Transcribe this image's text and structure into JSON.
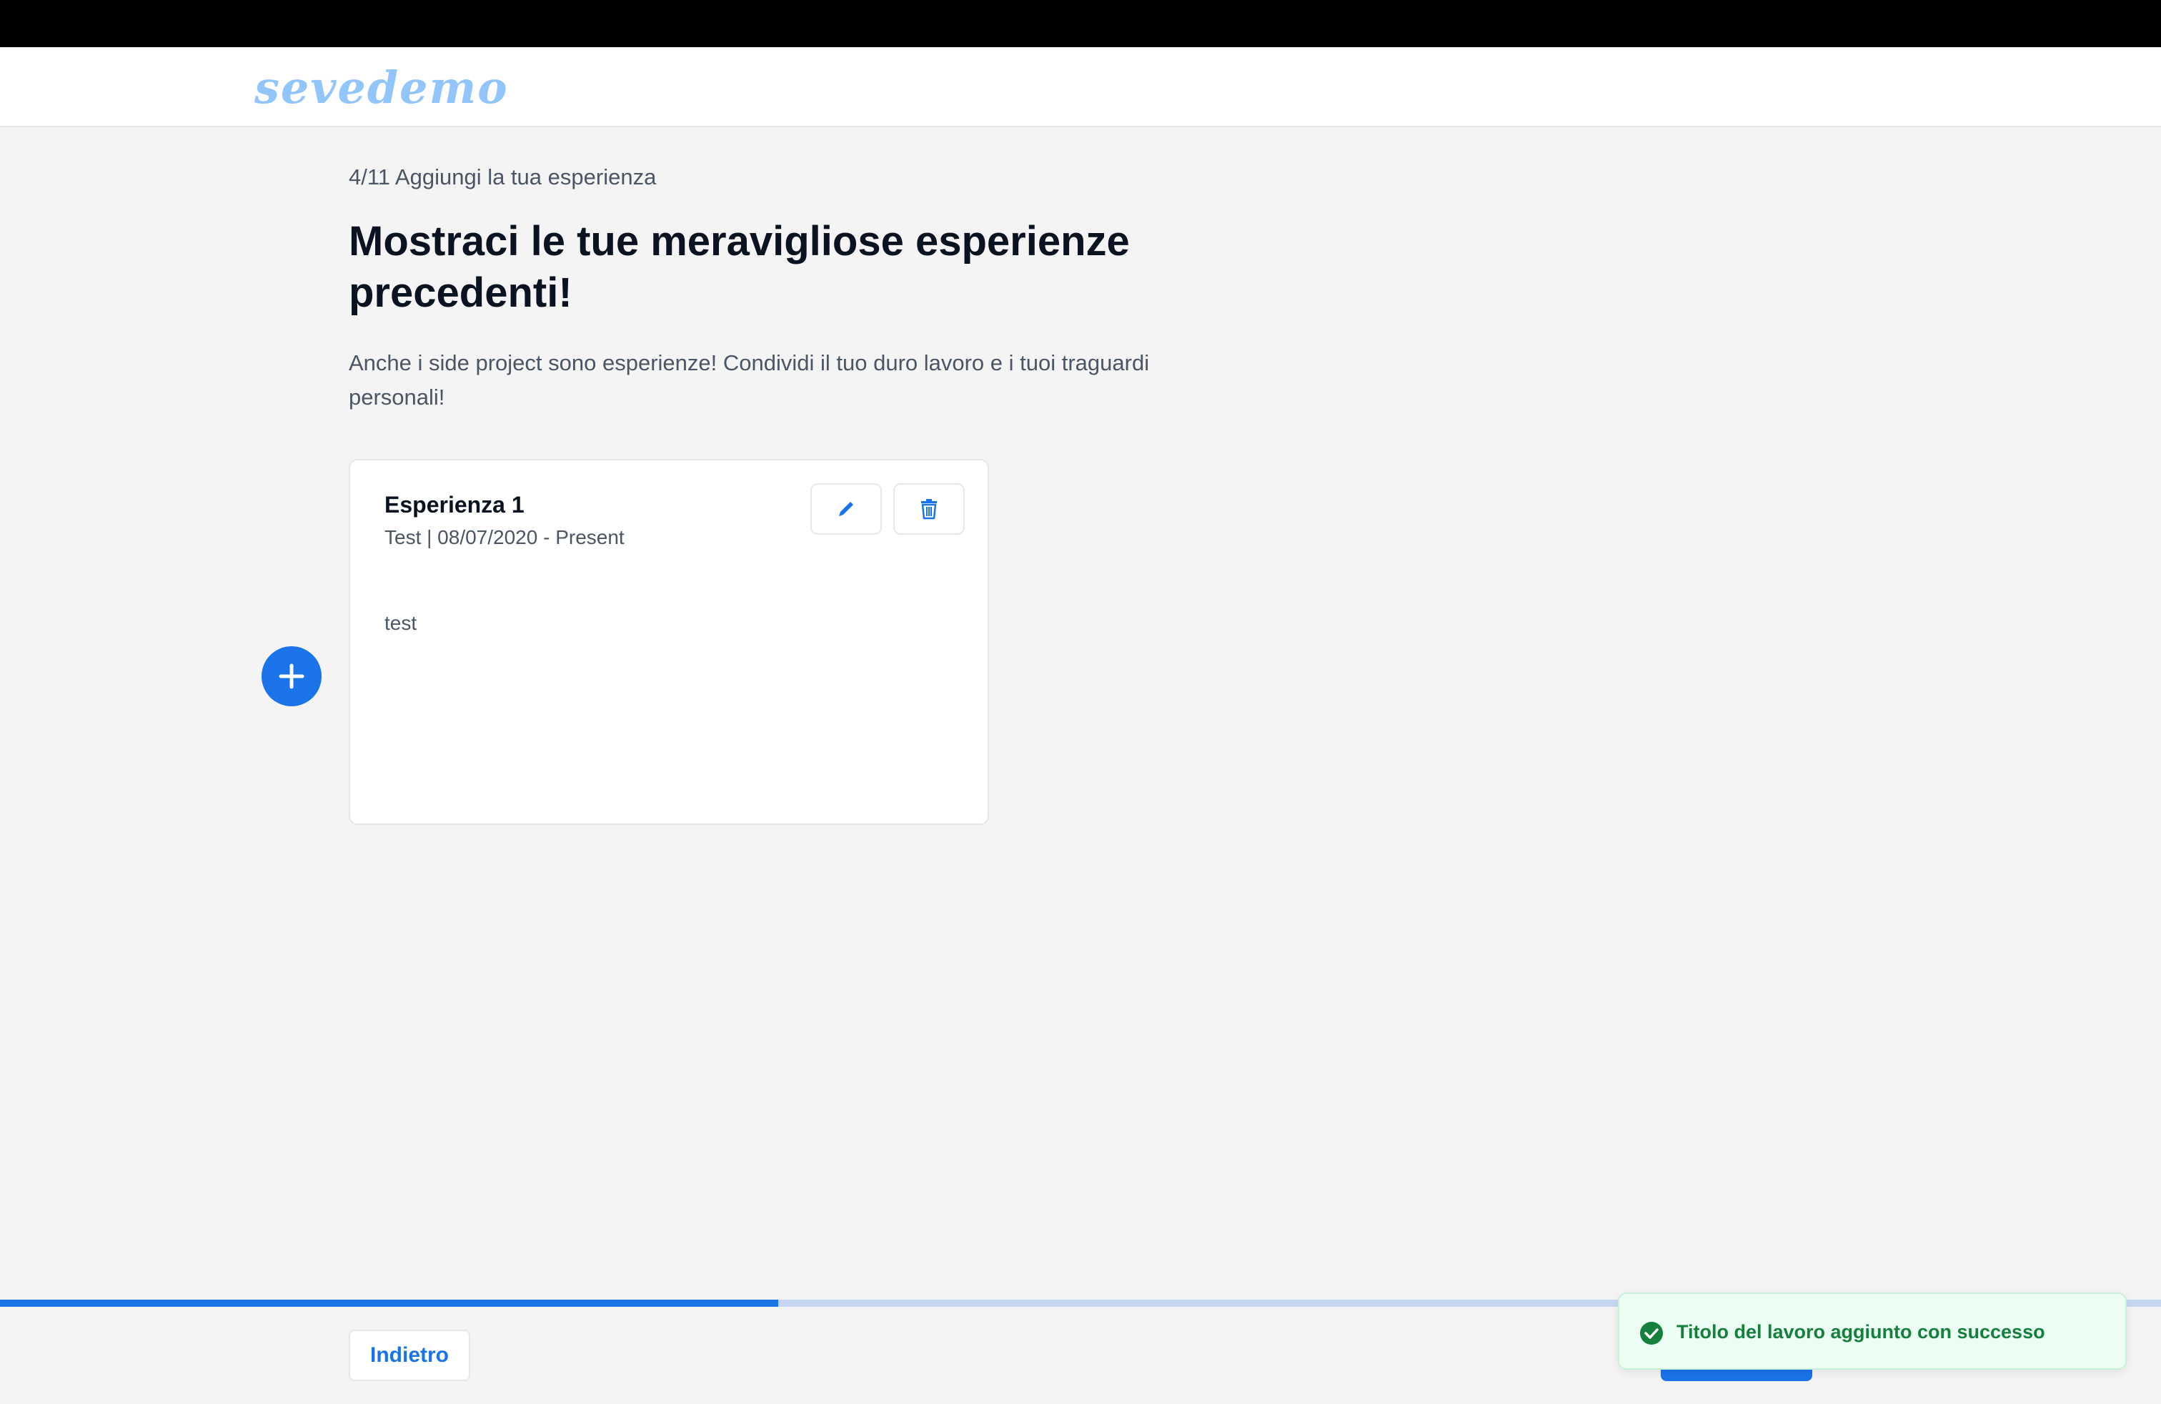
{
  "header": {
    "logo_text": "sevedemo"
  },
  "page": {
    "step": "4/11 Aggiungi la tua esperienza",
    "title": "Mostraci le tue meravigliose esperienze precedenti!",
    "subtitle": "Anche i side project sono esperienze! Condividi il tuo duro lavoro e i tuoi traguardi personali!"
  },
  "experience_card": {
    "title": "Esperienza 1",
    "meta": "Test | 08/07/2020 - Present",
    "description": "test",
    "edit_icon": "pencil-icon",
    "delete_icon": "trash-icon"
  },
  "add_button": {
    "icon": "plus-icon"
  },
  "progress": {
    "fraction": 0.36
  },
  "footer": {
    "back_label": "Indietro"
  },
  "toast": {
    "message": "Titolo del lavoro aggiunto con successo",
    "icon": "check-circle-icon"
  },
  "colors": {
    "accent": "#1a73e8",
    "logo": "#93c5fd",
    "success": "#15803d",
    "background": "#f4f4f5"
  }
}
